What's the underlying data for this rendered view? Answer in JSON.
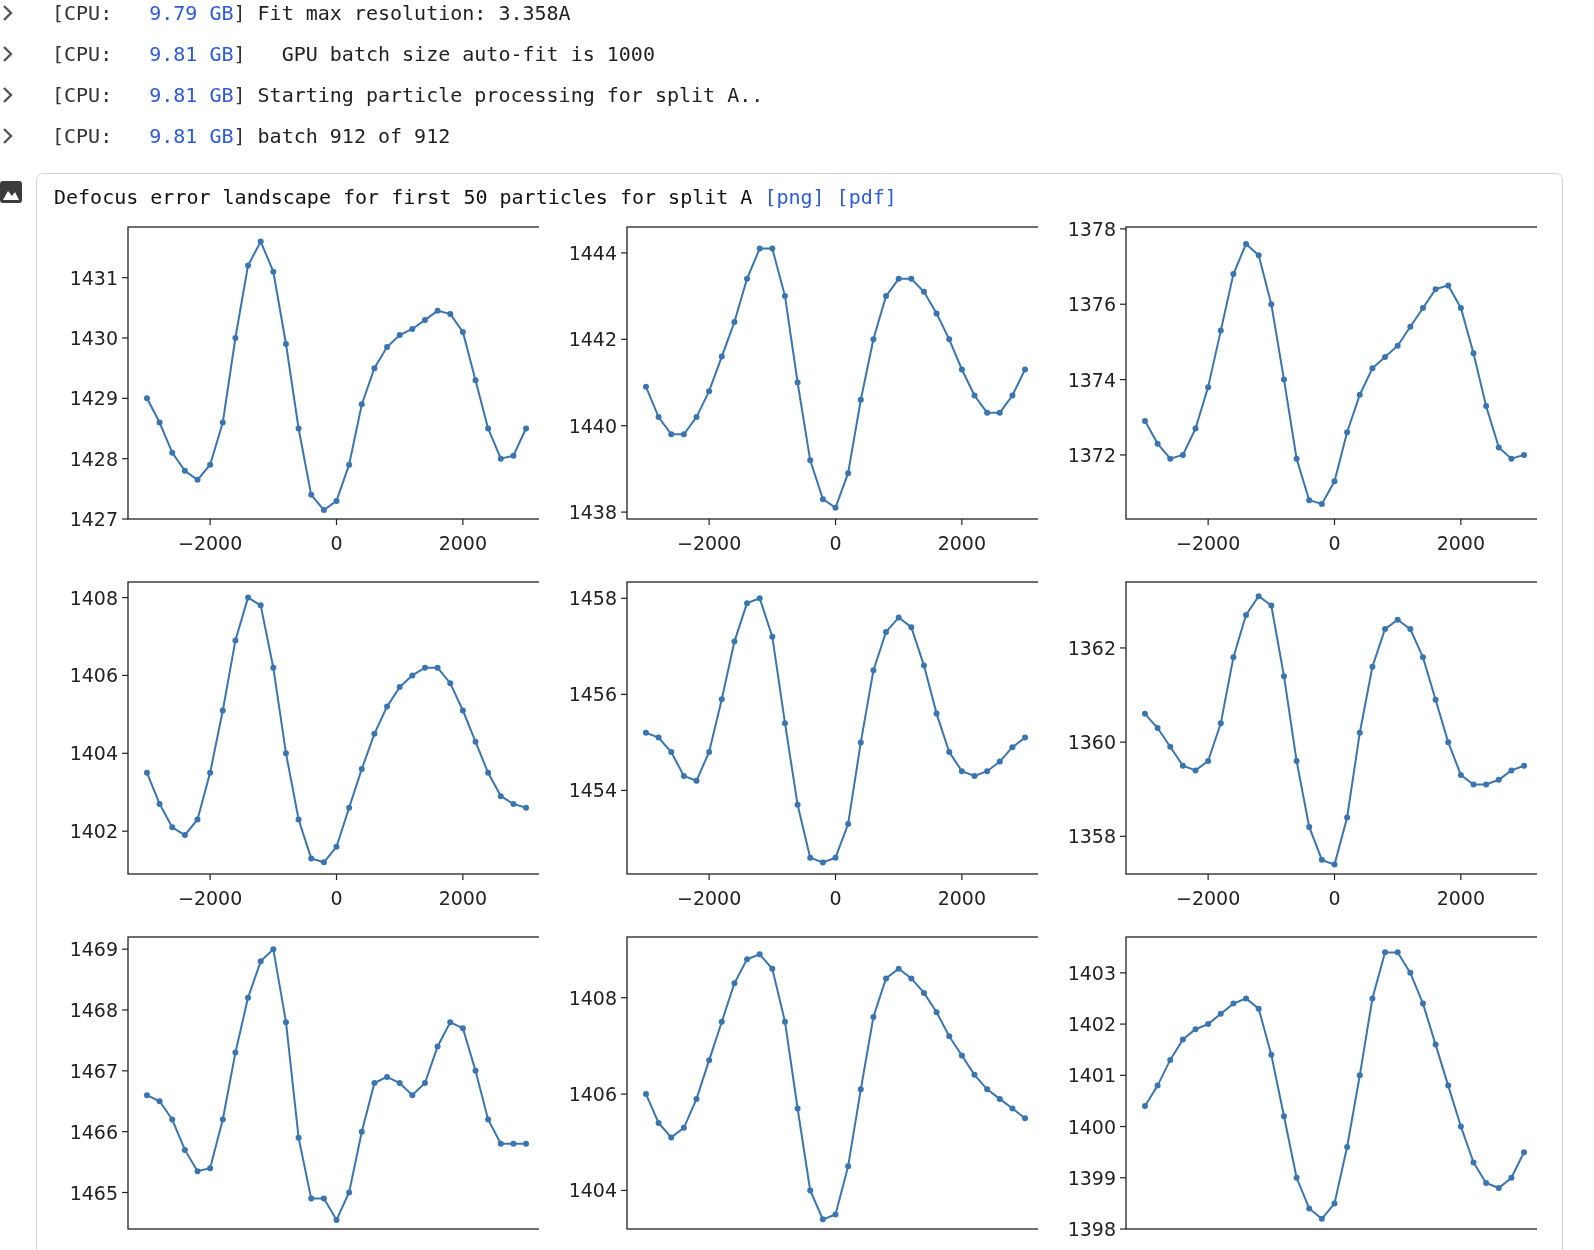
{
  "log_lines": [
    {
      "cpu_label": "[CPU:",
      "memory": "9.79 GB",
      "close": "]",
      "message": "Fit max resolution: 3.358A"
    },
    {
      "cpu_label": "[CPU:",
      "memory": "9.81 GB",
      "close": "]",
      "message": "  GPU batch size auto-fit is 1000"
    },
    {
      "cpu_label": "[CPU:",
      "memory": "9.81 GB",
      "close": "]",
      "message": "Starting particle processing for split A.."
    },
    {
      "cpu_label": "[CPU:",
      "memory": "9.81 GB",
      "close": "]",
      "message": "batch 912 of 912"
    }
  ],
  "figure": {
    "title": "Defocus error landscape for first 50 particles for split A",
    "links": [
      "[png]",
      "[pdf]"
    ],
    "charts": [
      {
        "chart_data": {
          "type": "line",
          "xlim": [
            -3300,
            3300
          ],
          "ylim": [
            1427,
            1431.84
          ],
          "xticks": [
            -2000,
            0,
            2000
          ],
          "yticks": [
            1427,
            1428,
            1429,
            1430,
            1431
          ],
          "x": [
            -3000,
            -2800,
            -2600,
            -2400,
            -2200,
            -2000,
            -1800,
            -1600,
            -1400,
            -1200,
            -1000,
            -800,
            -600,
            -400,
            -200,
            0,
            200,
            400,
            600,
            800,
            1000,
            1200,
            1400,
            1600,
            1800,
            2000,
            2200,
            2400,
            2600,
            2800,
            3000
          ],
          "series": [
            {
              "color": "#3b75af",
              "marker": "o",
              "values": [
                1429.0,
                1428.6,
                1428.1,
                1427.8,
                1427.65,
                1427.9,
                1428.6,
                1430.0,
                1431.2,
                1431.6,
                1431.1,
                1429.9,
                1428.5,
                1427.4,
                1427.15,
                1427.3,
                1427.9,
                1428.9,
                1429.5,
                1429.85,
                1430.05,
                1430.15,
                1430.3,
                1430.45,
                1430.4,
                1430.1,
                1429.3,
                1428.5,
                1428.0,
                1428.05,
                1428.5
              ]
            }
          ]
        }
      },
      {
        "chart_data": {
          "type": "line",
          "xlim": [
            -3300,
            3300
          ],
          "ylim": [
            1437.84,
            1444.6
          ],
          "xticks": [
            -2000,
            0,
            2000
          ],
          "yticks": [
            1438,
            1440,
            1442,
            1444
          ],
          "x": [
            -3000,
            -2800,
            -2600,
            -2400,
            -2200,
            -2000,
            -1800,
            -1600,
            -1400,
            -1200,
            -1000,
            -800,
            -600,
            -400,
            -200,
            0,
            200,
            400,
            600,
            800,
            1000,
            1200,
            1400,
            1600,
            1800,
            2000,
            2200,
            2400,
            2600,
            2800,
            3000
          ],
          "series": [
            {
              "color": "#3b75af",
              "marker": "o",
              "values": [
                1440.9,
                1440.2,
                1439.8,
                1439.8,
                1440.2,
                1440.8,
                1441.6,
                1442.4,
                1443.4,
                1444.1,
                1444.1,
                1443.0,
                1441.0,
                1439.2,
                1438.3,
                1438.1,
                1438.9,
                1440.6,
                1442.0,
                1443.0,
                1443.4,
                1443.4,
                1443.1,
                1442.6,
                1442.0,
                1441.3,
                1440.7,
                1440.3,
                1440.3,
                1440.7,
                1441.3
              ]
            }
          ]
        }
      },
      {
        "chart_data": {
          "type": "line",
          "xlim": [
            -3300,
            3300
          ],
          "ylim": [
            1370.3,
            1378.05
          ],
          "xticks": [
            -2000,
            0,
            2000
          ],
          "yticks": [
            1372,
            1374,
            1376,
            1378
          ],
          "x": [
            -3000,
            -2800,
            -2600,
            -2400,
            -2200,
            -2000,
            -1800,
            -1600,
            -1400,
            -1200,
            -1000,
            -800,
            -600,
            -400,
            -200,
            0,
            200,
            400,
            600,
            800,
            1000,
            1200,
            1400,
            1600,
            1800,
            2000,
            2200,
            2400,
            2600,
            2800,
            3000
          ],
          "series": [
            {
              "color": "#3b75af",
              "marker": "o",
              "values": [
                1372.9,
                1372.3,
                1371.9,
                1372.0,
                1372.7,
                1373.8,
                1375.3,
                1376.8,
                1377.6,
                1377.3,
                1376.0,
                1374.0,
                1371.9,
                1370.8,
                1370.7,
                1371.3,
                1372.6,
                1373.6,
                1374.3,
                1374.6,
                1374.9,
                1375.4,
                1375.9,
                1376.4,
                1376.5,
                1375.9,
                1374.7,
                1373.3,
                1372.2,
                1371.9,
                1372.0
              ]
            }
          ]
        }
      },
      {
        "chart_data": {
          "type": "line",
          "xlim": [
            -3300,
            3300
          ],
          "ylim": [
            1400.9,
            1408.4
          ],
          "xticks": [
            -2000,
            0,
            2000
          ],
          "yticks": [
            1402,
            1404,
            1406,
            1408
          ],
          "x": [
            -3000,
            -2800,
            -2600,
            -2400,
            -2200,
            -2000,
            -1800,
            -1600,
            -1400,
            -1200,
            -1000,
            -800,
            -600,
            -400,
            -200,
            0,
            200,
            400,
            600,
            800,
            1000,
            1200,
            1400,
            1600,
            1800,
            2000,
            2200,
            2400,
            2600,
            2800,
            3000
          ],
          "series": [
            {
              "color": "#3b75af",
              "marker": "o",
              "values": [
                1403.5,
                1402.7,
                1402.1,
                1401.9,
                1402.3,
                1403.5,
                1405.1,
                1406.9,
                1408.0,
                1407.8,
                1406.2,
                1404.0,
                1402.3,
                1401.3,
                1401.2,
                1401.6,
                1402.6,
                1403.6,
                1404.5,
                1405.2,
                1405.7,
                1406.0,
                1406.2,
                1406.2,
                1405.8,
                1405.1,
                1404.3,
                1403.5,
                1402.9,
                1402.7,
                1402.6
              ]
            }
          ]
        }
      },
      {
        "chart_data": {
          "type": "line",
          "xlim": [
            -3300,
            3300
          ],
          "ylim": [
            1452.26,
            1458.34
          ],
          "xticks": [
            -2000,
            0,
            2000
          ],
          "yticks": [
            1454,
            1456,
            1458
          ],
          "x": [
            -3000,
            -2800,
            -2600,
            -2400,
            -2200,
            -2000,
            -1800,
            -1600,
            -1400,
            -1200,
            -1000,
            -800,
            -600,
            -400,
            -200,
            0,
            200,
            400,
            600,
            800,
            1000,
            1200,
            1400,
            1600,
            1800,
            2000,
            2200,
            2400,
            2600,
            2800,
            3000
          ],
          "series": [
            {
              "color": "#3b75af",
              "marker": "o",
              "values": [
                1455.2,
                1455.1,
                1454.8,
                1454.3,
                1454.2,
                1454.8,
                1455.9,
                1457.1,
                1457.9,
                1458.0,
                1457.2,
                1455.4,
                1453.7,
                1452.6,
                1452.5,
                1452.6,
                1453.3,
                1455.0,
                1456.5,
                1457.3,
                1457.6,
                1457.4,
                1456.6,
                1455.6,
                1454.8,
                1454.4,
                1454.3,
                1454.4,
                1454.6,
                1454.9,
                1455.1
              ]
            }
          ]
        }
      },
      {
        "chart_data": {
          "type": "line",
          "xlim": [
            -3300,
            3300
          ],
          "ylim": [
            1357.2,
            1363.4
          ],
          "xticks": [
            -2000,
            0,
            2000
          ],
          "yticks": [
            1358,
            1360,
            1362
          ],
          "x": [
            -3000,
            -2800,
            -2600,
            -2400,
            -2200,
            -2000,
            -1800,
            -1600,
            -1400,
            -1200,
            -1000,
            -800,
            -600,
            -400,
            -200,
            0,
            200,
            400,
            600,
            800,
            1000,
            1200,
            1400,
            1600,
            1800,
            2000,
            2200,
            2400,
            2600,
            2800,
            3000
          ],
          "series": [
            {
              "color": "#3b75af",
              "marker": "o",
              "values": [
                1360.6,
                1360.3,
                1359.9,
                1359.5,
                1359.4,
                1359.6,
                1360.4,
                1361.8,
                1362.7,
                1363.1,
                1362.9,
                1361.4,
                1359.6,
                1358.2,
                1357.5,
                1357.4,
                1358.4,
                1360.2,
                1361.6,
                1362.4,
                1362.6,
                1362.4,
                1361.8,
                1360.9,
                1360.0,
                1359.3,
                1359.1,
                1359.1,
                1359.2,
                1359.4,
                1359.5
              ]
            }
          ]
        }
      },
      {
        "chart_data": {
          "type": "line",
          "xlim": [
            -3300,
            3300
          ],
          "ylim": [
            1464.4,
            1469.2
          ],
          "yticks": [
            1465,
            1466,
            1467,
            1468,
            1469
          ],
          "x": [
            -3000,
            -2800,
            -2600,
            -2400,
            -2200,
            -2000,
            -1800,
            -1600,
            -1400,
            -1200,
            -1000,
            -800,
            -600,
            -400,
            -200,
            0,
            200,
            400,
            600,
            800,
            1000,
            1200,
            1400,
            1600,
            1800,
            2000,
            2200,
            2400,
            2600,
            2800,
            3000
          ],
          "series": [
            {
              "color": "#3b75af",
              "marker": "o",
              "values": [
                1466.6,
                1466.5,
                1466.2,
                1465.7,
                1465.35,
                1465.4,
                1466.2,
                1467.3,
                1468.2,
                1468.8,
                1469.0,
                1467.8,
                1465.9,
                1464.9,
                1464.9,
                1464.55,
                1465.0,
                1466.0,
                1466.8,
                1466.9,
                1466.8,
                1466.6,
                1466.8,
                1467.4,
                1467.8,
                1467.7,
                1467.0,
                1466.2,
                1465.8,
                1465.8,
                1465.8
              ]
            }
          ]
        }
      },
      {
        "chart_data": {
          "type": "line",
          "xlim": [
            -3300,
            3300
          ],
          "ylim": [
            1403.2,
            1409.26
          ],
          "yticks": [
            1404,
            1406,
            1408
          ],
          "x": [
            -3000,
            -2800,
            -2600,
            -2400,
            -2200,
            -2000,
            -1800,
            -1600,
            -1400,
            -1200,
            -1000,
            -800,
            -600,
            -400,
            -200,
            0,
            200,
            400,
            600,
            800,
            1000,
            1200,
            1400,
            1600,
            1800,
            2000,
            2200,
            2400,
            2600,
            2800,
            3000
          ],
          "series": [
            {
              "color": "#3b75af",
              "marker": "o",
              "values": [
                1406.0,
                1405.4,
                1405.1,
                1405.3,
                1405.9,
                1406.7,
                1407.5,
                1408.3,
                1408.8,
                1408.9,
                1408.6,
                1407.5,
                1405.7,
                1404.0,
                1403.4,
                1403.5,
                1404.5,
                1406.1,
                1407.6,
                1408.4,
                1408.6,
                1408.4,
                1408.1,
                1407.7,
                1407.2,
                1406.8,
                1406.4,
                1406.1,
                1405.9,
                1405.7,
                1405.5
              ]
            }
          ]
        }
      },
      {
        "chart_data": {
          "type": "line",
          "xlim": [
            -3300,
            3300
          ],
          "ylim": [
            1398,
            1403.7
          ],
          "yticks": [
            1398,
            1399,
            1400,
            1401,
            1402,
            1403
          ],
          "x": [
            -3000,
            -2800,
            -2600,
            -2400,
            -2200,
            -2000,
            -1800,
            -1600,
            -1400,
            -1200,
            -1000,
            -800,
            -600,
            -400,
            -200,
            0,
            200,
            400,
            600,
            800,
            1000,
            1200,
            1400,
            1600,
            1800,
            2000,
            2200,
            2400,
            2600,
            2800,
            3000
          ],
          "series": [
            {
              "color": "#3b75af",
              "marker": "o",
              "values": [
                1400.4,
                1400.8,
                1401.3,
                1401.7,
                1401.9,
                1402.0,
                1402.2,
                1402.4,
                1402.5,
                1402.3,
                1401.4,
                1400.2,
                1399.0,
                1398.4,
                1398.2,
                1398.5,
                1399.6,
                1401.0,
                1402.5,
                1403.4,
                1403.4,
                1403.0,
                1402.4,
                1401.6,
                1400.8,
                1400.0,
                1399.3,
                1398.9,
                1398.8,
                1399.0,
                1399.5
              ]
            }
          ]
        }
      }
    ]
  }
}
